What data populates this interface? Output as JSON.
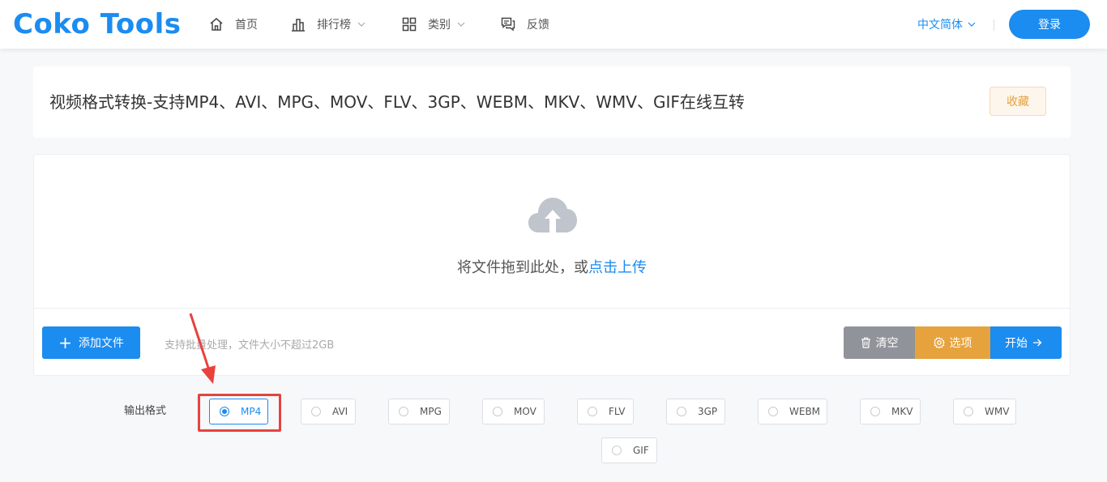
{
  "header": {
    "logo": "Coko Tools",
    "nav": [
      {
        "label": "首页",
        "icon": "home-icon"
      },
      {
        "label": "排行榜",
        "icon": "bar-chart-icon"
      },
      {
        "label": "类别",
        "icon": "grid-icon"
      },
      {
        "label": "反馈",
        "icon": "feedback-icon"
      }
    ],
    "language": "中文简体",
    "login": "登录"
  },
  "title_card": {
    "title": "视频格式转换-支持MP4、AVI、MPG、MOV、FLV、3GP、WEBM、MKV、WMV、GIF在线互转",
    "favorite": "收藏"
  },
  "upload": {
    "drop_text": "将文件拖到此处，或",
    "drop_link": "点击上传",
    "add_file": "添加文件",
    "hint": "支持批量处理，文件大小不超过2GB",
    "clear": "清空",
    "options": "选项",
    "start": "开始"
  },
  "output": {
    "label": "输出格式",
    "formats": [
      "MP4",
      "AVI",
      "MPG",
      "MOV",
      "FLV",
      "3GP",
      "WEBM",
      "MKV",
      "WMV",
      "GIF"
    ],
    "selected": "MP4"
  },
  "colors": {
    "primary": "#1b8cf0",
    "warning": "#e6a23c",
    "gray": "#909399",
    "annotation": "#e8423f"
  }
}
